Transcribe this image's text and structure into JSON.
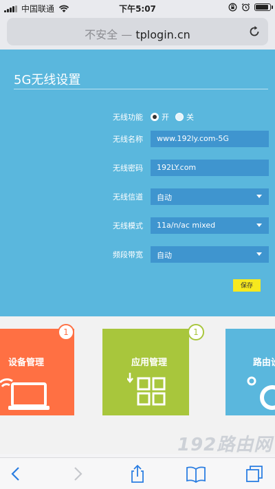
{
  "status_bar": {
    "carrier": "中国联通",
    "time": "下午5:07",
    "battery_level": 0.95
  },
  "browser": {
    "url_insecure": "不安全",
    "url_separator": "—",
    "url_host": "tplogin.cn"
  },
  "settings": {
    "title": "5G无线设置",
    "radio_label": "无线功能",
    "radio_on": "开",
    "radio_off": "关",
    "ssid_label": "无线名称",
    "ssid_value": "www.192ly.com-5G",
    "password_label": "无线密码",
    "password_value": "192LY.com",
    "channel_label": "无线信道",
    "channel_value": "自动",
    "mode_label": "无线模式",
    "mode_value": "11a/n/ac mixed",
    "bandwidth_label": "频段带宽",
    "bandwidth_value": "自动",
    "save_label": "保存"
  },
  "tiles": [
    {
      "label": "设备管理",
      "badge": "1",
      "color": "#ff7043",
      "badge_color": "#ff7043"
    },
    {
      "label": "应用管理",
      "badge": "1",
      "color": "#a8c63c",
      "badge_color": "#a8c63c"
    },
    {
      "label": "路由设",
      "color": "#5ab7dd"
    }
  ],
  "watermark": "192路由网",
  "colors": {
    "panel": "#5ab7dd",
    "field": "#3f95cf",
    "save": "#f7e91e",
    "toolbar_icon": "#2a7de1"
  }
}
